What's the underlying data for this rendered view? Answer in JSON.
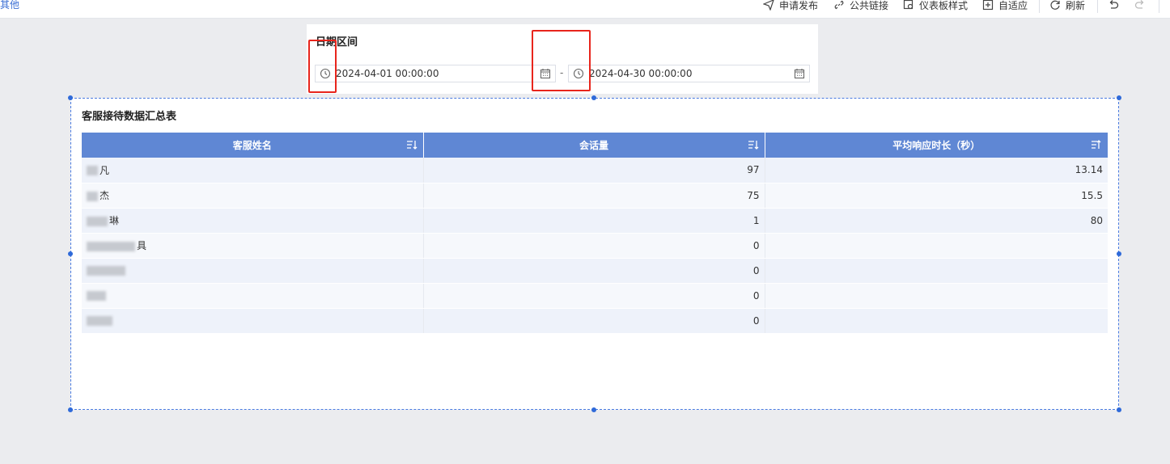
{
  "toolbar": {
    "left_link": "其他",
    "items": [
      {
        "label": "申请发布",
        "icon": "send-icon"
      },
      {
        "label": "公共链接",
        "icon": "link-icon"
      },
      {
        "label": "仪表板样式",
        "icon": "dashboard-style-icon"
      },
      {
        "label": "自适应",
        "icon": "fit-icon"
      },
      {
        "label": "刷新",
        "icon": "refresh-icon"
      }
    ],
    "undo_icon": "undo-icon",
    "redo_icon": "redo-icon"
  },
  "date_filter": {
    "title": "日期区间",
    "start": "2024-04-01 00:00:00",
    "end": "2024-04-30 00:00:00",
    "separator": "-"
  },
  "table_widget": {
    "title": "客服接待数据汇总表",
    "columns": [
      "客服姓名",
      "会话量",
      "平均响应时长（秒）"
    ],
    "rows": [
      {
        "name": "凡",
        "sessions": "97",
        "avg": "13.14"
      },
      {
        "name": "杰",
        "sessions": "75",
        "avg": "15.5"
      },
      {
        "name": "琳",
        "sessions": "1",
        "avg": "80"
      },
      {
        "name": "具",
        "sessions": "0",
        "avg": ""
      },
      {
        "name": "",
        "sessions": "0",
        "avg": ""
      },
      {
        "name": "",
        "sessions": "0",
        "avg": ""
      },
      {
        "name": "",
        "sessions": "0",
        "avg": ""
      }
    ]
  },
  "colors": {
    "accent": "#5f87d4",
    "highlight": "#e8251c",
    "selection": "#2f6ad9"
  }
}
